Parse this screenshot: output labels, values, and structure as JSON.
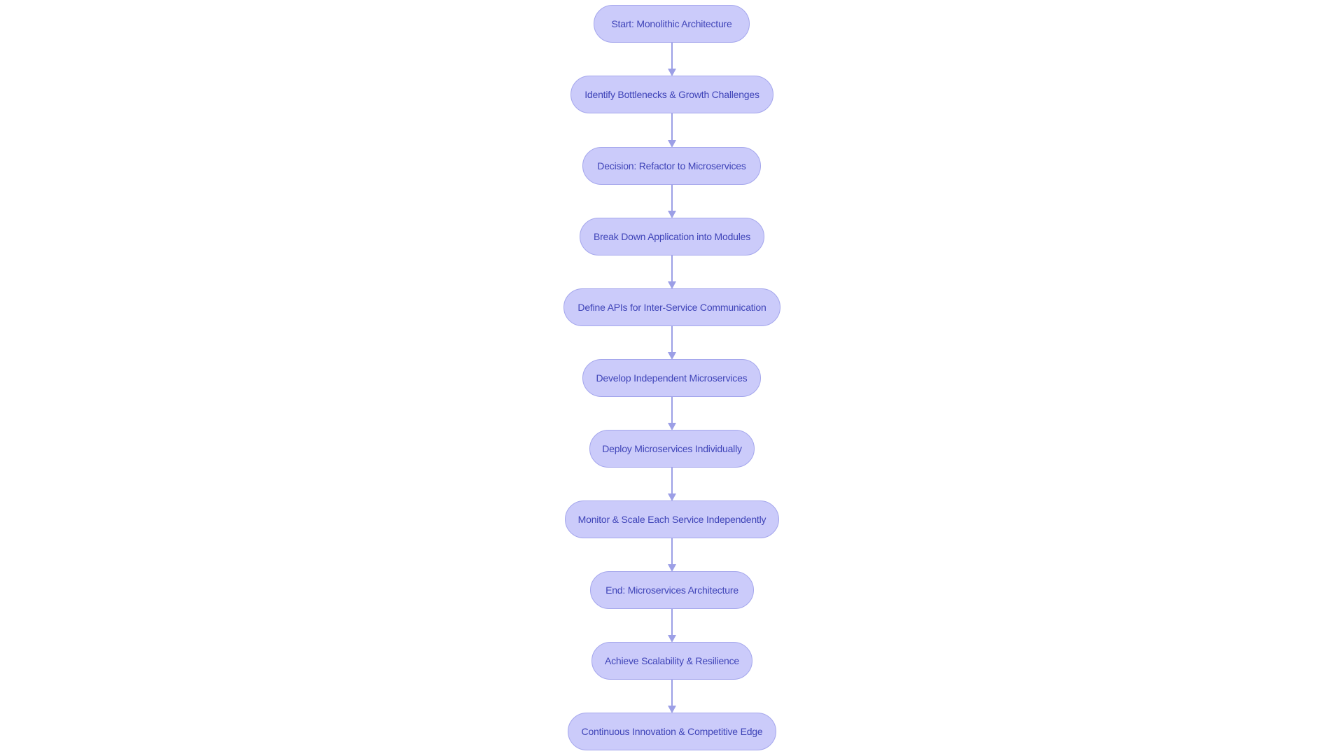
{
  "diagram": {
    "type": "flowchart",
    "direction": "top-to-bottom",
    "colors": {
      "node_fill": "#cbcbfa",
      "node_border": "#a4a6ec",
      "node_text": "#3f44b8",
      "edge": "#9c9fe6",
      "background": "#ffffff"
    },
    "nodes": [
      {
        "id": "n1",
        "label": "Start: Monolithic Architecture"
      },
      {
        "id": "n2",
        "label": "Identify Bottlenecks & Growth Challenges"
      },
      {
        "id": "n3",
        "label": "Decision: Refactor to Microservices"
      },
      {
        "id": "n4",
        "label": "Break Down Application into Modules"
      },
      {
        "id": "n5",
        "label": "Define APIs for Inter-Service Communication"
      },
      {
        "id": "n6",
        "label": "Develop Independent Microservices"
      },
      {
        "id": "n7",
        "label": "Deploy Microservices Individually"
      },
      {
        "id": "n8",
        "label": "Monitor & Scale Each Service Independently"
      },
      {
        "id": "n9",
        "label": "End: Microservices Architecture"
      },
      {
        "id": "n10",
        "label": "Achieve Scalability & Resilience"
      },
      {
        "id": "n11",
        "label": "Continuous Innovation & Competitive Edge"
      }
    ],
    "edges": [
      {
        "from": "n1",
        "to": "n2"
      },
      {
        "from": "n2",
        "to": "n3"
      },
      {
        "from": "n3",
        "to": "n4"
      },
      {
        "from": "n4",
        "to": "n5"
      },
      {
        "from": "n5",
        "to": "n6"
      },
      {
        "from": "n6",
        "to": "n7"
      },
      {
        "from": "n7",
        "to": "n8"
      },
      {
        "from": "n8",
        "to": "n9"
      },
      {
        "from": "n9",
        "to": "n10"
      },
      {
        "from": "n10",
        "to": "n11"
      }
    ]
  }
}
